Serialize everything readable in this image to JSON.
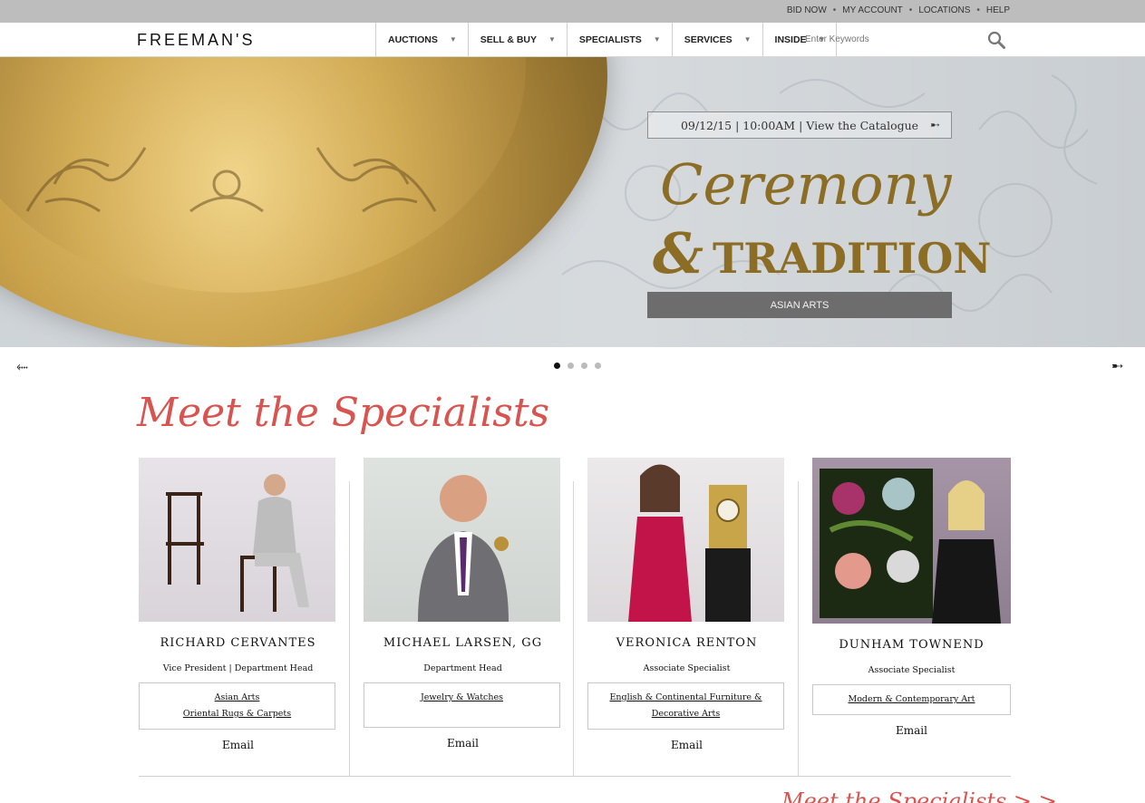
{
  "utility_links": [
    "BID NOW",
    "MY ACCOUNT",
    "LOCATIONS",
    "HELP"
  ],
  "logo": "FREEMAN'S",
  "nav": [
    {
      "label": "AUCTIONS"
    },
    {
      "label": "SELL & BUY"
    },
    {
      "label": "SPECIALISTS"
    },
    {
      "label": "SERVICES"
    },
    {
      "label": "INSIDE"
    }
  ],
  "search": {
    "placeholder": "Enter Keywords",
    "icon": "magnifier-icon"
  },
  "hero": {
    "catalogue_link": "09/12/15 | 10:00AM | View the Catalogue",
    "title_line1": "Ceremony",
    "title_amp": "&",
    "title_line2": "TRADITION",
    "category_button": "ASIAN ARTS",
    "prev_icon": "arrow-left-icon",
    "next_icon": "arrow-right-icon",
    "slide_count": 4,
    "active_slide": 1
  },
  "specialists_heading": "Meet the Specialists",
  "specialists": [
    {
      "name": "RICHARD CERVANTES",
      "title": "Vice President | Department Head",
      "departments": [
        "Asian Arts",
        "Oriental Rugs & Carpets"
      ],
      "email": "Email"
    },
    {
      "name": "MICHAEL LARSEN, GG",
      "title": "Department Head",
      "departments": [
        "Jewelry & Watches"
      ],
      "email": "Email"
    },
    {
      "name": "VERONICA RENTON",
      "title": "Associate Specialist",
      "departments": [
        "English & Continental Furniture & Decorative Arts"
      ],
      "email": "Email"
    },
    {
      "name": "DUNHAM TOWNEND",
      "title": "Associate Specialist",
      "departments": [
        "Modern & Contemporary Art"
      ],
      "email": "Email"
    }
  ],
  "more_link": "Meet the Specialists > >"
}
